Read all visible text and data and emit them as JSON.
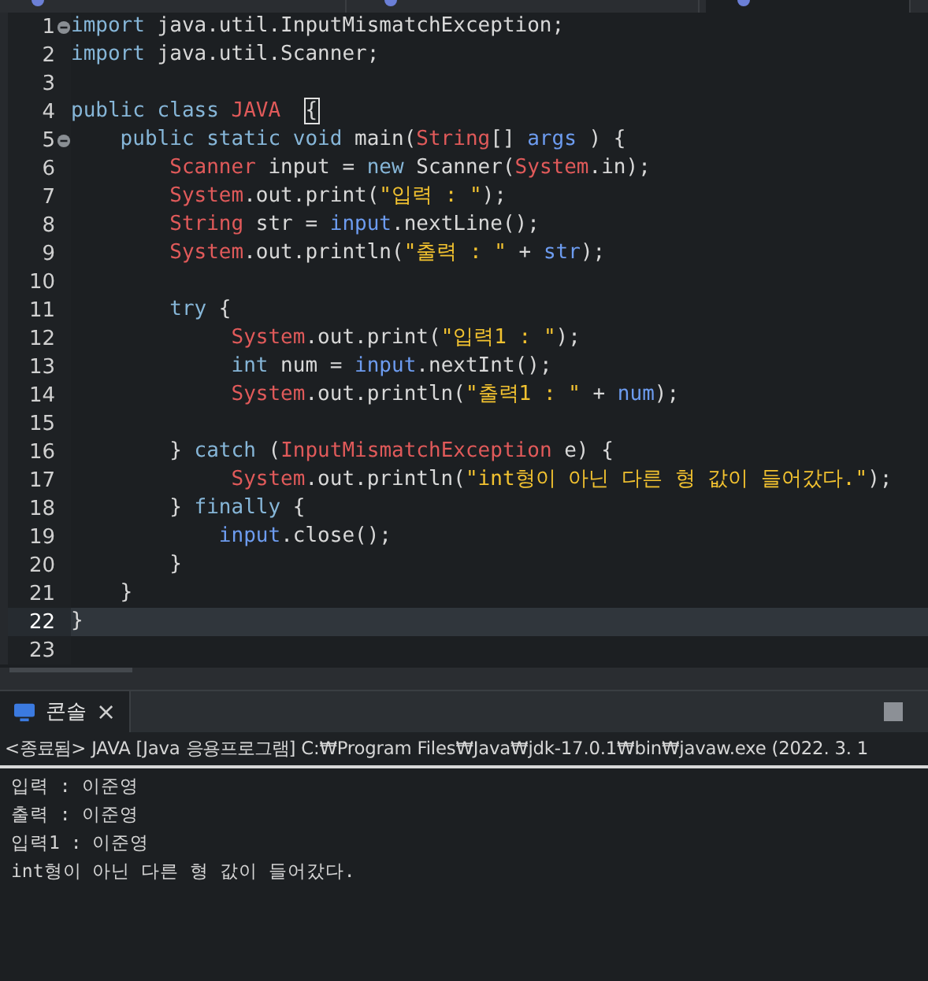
{
  "editor_tabs": [
    {
      "selected": false
    },
    {
      "selected": false
    },
    {
      "selected": true
    }
  ],
  "code_lines": [
    {
      "number": "1",
      "foldable": true,
      "current": false,
      "tokens": [
        {
          "kind": "keyword",
          "text": "import"
        },
        {
          "kind": "plain",
          "text": " java.util.InputMismatchException;"
        }
      ]
    },
    {
      "number": "2",
      "foldable": false,
      "current": false,
      "tokens": [
        {
          "kind": "keyword",
          "text": "import"
        },
        {
          "kind": "plain",
          "text": " java.util.Scanner;"
        }
      ]
    },
    {
      "number": "3",
      "foldable": false,
      "current": false
    },
    {
      "number": "4",
      "foldable": false,
      "current": false,
      "tokens": [
        {
          "kind": "keyword",
          "text": "public class "
        },
        {
          "kind": "type",
          "text": "JAVA  "
        },
        {
          "kind": "match",
          "text": "{"
        }
      ]
    },
    {
      "number": "5",
      "foldable": true,
      "current": false,
      "tokens": [
        {
          "kind": "keyword",
          "text": "    public static void "
        },
        {
          "kind": "plain",
          "text": "main("
        },
        {
          "kind": "type",
          "text": "String"
        },
        {
          "kind": "plain",
          "text": "[] "
        },
        {
          "kind": "variable",
          "text": "args"
        },
        {
          "kind": "plain",
          "text": " ) {"
        }
      ]
    },
    {
      "number": "6",
      "foldable": false,
      "current": false,
      "tokens": [
        {
          "kind": "type",
          "text": "        Scanner"
        },
        {
          "kind": "plain",
          "text": " input = "
        },
        {
          "kind": "keyword",
          "text": "new"
        },
        {
          "kind": "plain",
          "text": " Scanner("
        },
        {
          "kind": "type",
          "text": "System"
        },
        {
          "kind": "plain",
          "text": ".in);"
        }
      ]
    },
    {
      "number": "7",
      "foldable": false,
      "current": false,
      "tokens": [
        {
          "kind": "type",
          "text": "        System"
        },
        {
          "kind": "plain",
          "text": ".out.print("
        },
        {
          "kind": "string",
          "text": "\"입력 : \""
        },
        {
          "kind": "plain",
          "text": ");"
        }
      ]
    },
    {
      "number": "8",
      "foldable": false,
      "current": false,
      "tokens": [
        {
          "kind": "type",
          "text": "        String"
        },
        {
          "kind": "plain",
          "text": " str = "
        },
        {
          "kind": "variable",
          "text": "input"
        },
        {
          "kind": "plain",
          "text": ".nextLine();"
        }
      ]
    },
    {
      "number": "9",
      "foldable": false,
      "current": false,
      "tokens": [
        {
          "kind": "type",
          "text": "        System"
        },
        {
          "kind": "plain",
          "text": ".out.println("
        },
        {
          "kind": "string",
          "text": "\"출력 : \""
        },
        {
          "kind": "plain",
          "text": " + "
        },
        {
          "kind": "variable",
          "text": "str"
        },
        {
          "kind": "plain",
          "text": ");"
        }
      ]
    },
    {
      "number": "10",
      "foldable": false,
      "current": false
    },
    {
      "number": "11",
      "foldable": false,
      "current": false,
      "tokens": [
        {
          "kind": "keyword",
          "text": "        try"
        },
        {
          "kind": "plain",
          "text": " {"
        }
      ]
    },
    {
      "number": "12",
      "foldable": false,
      "current": false,
      "tokens": [
        {
          "kind": "type",
          "text": "             System"
        },
        {
          "kind": "plain",
          "text": ".out.print("
        },
        {
          "kind": "string",
          "text": "\"입력1 : \""
        },
        {
          "kind": "plain",
          "text": ");"
        }
      ]
    },
    {
      "number": "13",
      "foldable": false,
      "current": false,
      "tokens": [
        {
          "kind": "keyword",
          "text": "             int"
        },
        {
          "kind": "plain",
          "text": " num = "
        },
        {
          "kind": "variable",
          "text": "input"
        },
        {
          "kind": "plain",
          "text": ".nextInt();"
        }
      ]
    },
    {
      "number": "14",
      "foldable": false,
      "current": false,
      "tokens": [
        {
          "kind": "type",
          "text": "             System"
        },
        {
          "kind": "plain",
          "text": ".out.println("
        },
        {
          "kind": "string",
          "text": "\"출력1 : \""
        },
        {
          "kind": "plain",
          "text": " + "
        },
        {
          "kind": "variable",
          "text": "num"
        },
        {
          "kind": "plain",
          "text": ");"
        }
      ]
    },
    {
      "number": "15",
      "foldable": false,
      "current": false
    },
    {
      "number": "16",
      "foldable": false,
      "current": false,
      "tokens": [
        {
          "kind": "plain",
          "text": "        } "
        },
        {
          "kind": "keyword",
          "text": "catch"
        },
        {
          "kind": "plain",
          "text": " ("
        },
        {
          "kind": "type",
          "text": "InputMismatchException"
        },
        {
          "kind": "plain",
          "text": " e) {"
        }
      ]
    },
    {
      "number": "17",
      "foldable": false,
      "current": false,
      "tokens": [
        {
          "kind": "type",
          "text": "             System"
        },
        {
          "kind": "plain",
          "text": ".out.println("
        },
        {
          "kind": "string",
          "text": "\"int형이 아닌 다른 형 값이 들어갔다.\""
        },
        {
          "kind": "plain",
          "text": ");"
        }
      ]
    },
    {
      "number": "18",
      "foldable": false,
      "current": false,
      "tokens": [
        {
          "kind": "plain",
          "text": "        } "
        },
        {
          "kind": "keyword",
          "text": "finally"
        },
        {
          "kind": "plain",
          "text": " {"
        }
      ]
    },
    {
      "number": "19",
      "foldable": false,
      "current": false,
      "tokens": [
        {
          "kind": "variable",
          "text": "            input"
        },
        {
          "kind": "plain",
          "text": ".close();"
        }
      ]
    },
    {
      "number": "20",
      "foldable": false,
      "current": false,
      "tokens": [
        {
          "kind": "plain",
          "text": "        }"
        }
      ]
    },
    {
      "number": "21",
      "foldable": false,
      "current": false,
      "tokens": [
        {
          "kind": "plain",
          "text": "    }"
        }
      ]
    },
    {
      "number": "22",
      "foldable": false,
      "current": true,
      "tokens": [
        {
          "kind": "plain",
          "text": "}"
        }
      ]
    },
    {
      "number": "23",
      "foldable": false,
      "current": false
    }
  ],
  "console": {
    "tab_label": "콘솔",
    "close": "×",
    "header": "<종료됨> JAVA [Java 응용프로그램] C:₩Program Files₩Java₩jdk-17.0.1₩bin₩javaw.exe (2022. 3. 1",
    "output": [
      "입력 : 이준영",
      "출력 : 이준영",
      "입력1 : 이준영",
      "int형이 아닌 다른 형 값이 들어갔다."
    ]
  }
}
